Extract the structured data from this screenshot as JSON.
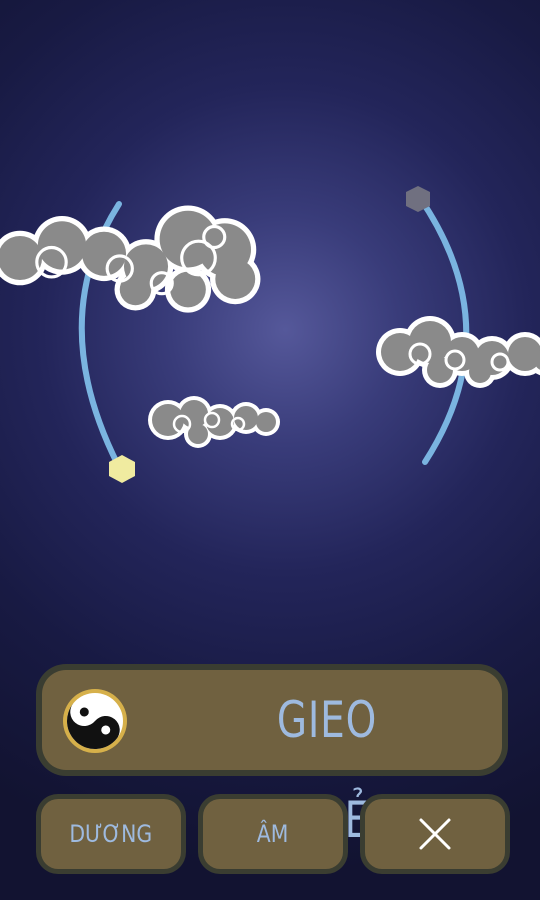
{
  "main_button": {
    "label": "GIEO QUẺ",
    "icon": "yin-yang-icon"
  },
  "buttons": [
    {
      "label": "DƯƠNG"
    },
    {
      "label": "ÂM"
    },
    {
      "label": "",
      "icon": "close-icon"
    }
  ],
  "scene": {
    "elements": [
      "left-bow-arc",
      "right-bow-arc",
      "yellow-hexagon-bead",
      "gray-hexagon-bead",
      "cloud"
    ]
  },
  "colors": {
    "background": "#181a43",
    "glow": "#55589a",
    "arc": "#7ab4e0",
    "cloud_fill": "#8a8a8a",
    "cloud_outline": "#ffffff",
    "yellow_bead": "#f0eba0",
    "gray_bead": "#707080",
    "button_fill": "#706140",
    "button_border": "#3a3d31",
    "button_text": "#9ebadf"
  }
}
